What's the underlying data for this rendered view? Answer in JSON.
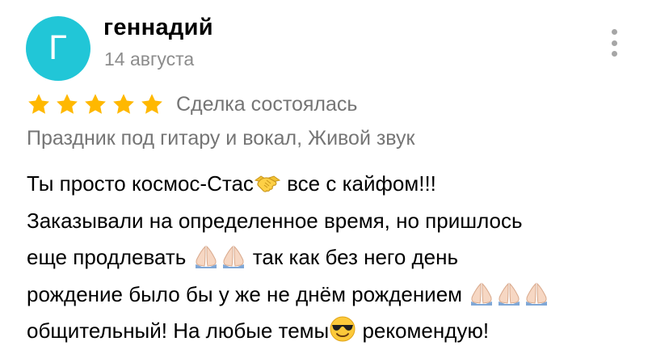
{
  "review": {
    "avatar_letter": "Г",
    "avatar_color": "#21c6d7",
    "author": "геннадий",
    "date": "14 августа",
    "rating": 5,
    "rating_max": 5,
    "star_color": "#ffb800",
    "deal_status": "Сделка состоялась",
    "service": "Праздник под гитару и вокал, Живой звук",
    "text": {
      "line1_a": "Ты просто космос-Стас",
      "line1_b": " все с кайфом!!!",
      "line2": "Заказывали на определенное время, но пришлось",
      "line3_a": "еще продлевать ",
      "line3_b": " так как без него день",
      "line4_a": "рождение было бы у же не днём рождением ",
      "line5_a": "общительный! На любые темы",
      "line5_b": " рекомендую!"
    },
    "emoji_icons": [
      "handshake-emoji",
      "folded-hands-emoji",
      "smiling-face-with-sunglasses-emoji"
    ]
  }
}
